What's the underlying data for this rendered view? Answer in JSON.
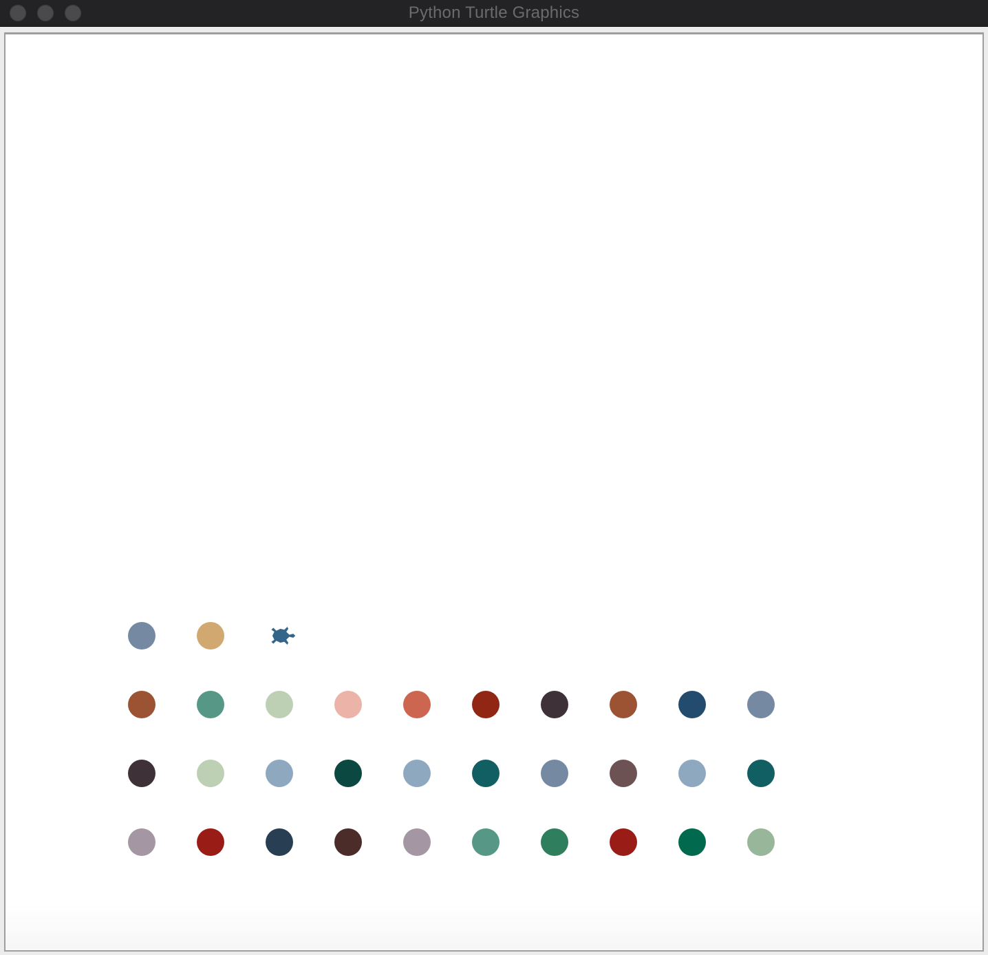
{
  "window": {
    "title": "Python Turtle Graphics",
    "titlebar_color": "#232326",
    "canvas_background": "#ffffff"
  },
  "turtle": {
    "icon": "turtle-icon",
    "color": "#33658a",
    "heading": "east",
    "row": 1,
    "column": 3
  },
  "dot_grid": {
    "rows": [
      [
        "#7589a2",
        "#d2a871"
      ],
      [
        "#9b5334",
        "#569885",
        "#bdd0b4",
        "#ecb3a8",
        "#cc6650",
        "#922615",
        "#3e3138",
        "#9b5334",
        "#234b6d",
        "#7589a2"
      ],
      [
        "#3e3138",
        "#bdd0b4",
        "#8ea9bf",
        "#0b4841",
        "#8ea9bf",
        "#125f63",
        "#7589a2",
        "#6d5253",
        "#8ea9bf",
        "#125f63"
      ],
      [
        "#a596a3",
        "#9a1c16",
        "#283e52",
        "#4c2c28",
        "#a596a3",
        "#569885",
        "#2f7f5f",
        "#9a1c16",
        "#00694e",
        "#98b69a"
      ]
    ]
  }
}
